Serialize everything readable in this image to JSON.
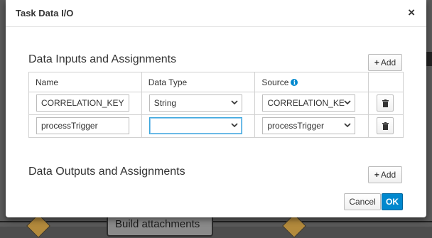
{
  "background": {
    "node_label": "Build attachments"
  },
  "dialog": {
    "title": "Task Data I/O",
    "close_symbol": "×",
    "inputs_section": {
      "title": "Data Inputs and Assignments",
      "add_label": "Add",
      "columns": [
        "Name",
        "Data Type",
        "Source"
      ],
      "rows": [
        {
          "name": "CORRELATION_KEY",
          "data_type": "String",
          "source": "CORRELATION_KE"
        },
        {
          "name": "processTrigger",
          "data_type": "",
          "source": "processTrigger"
        }
      ]
    },
    "outputs_section": {
      "title": "Data Outputs and Assignments",
      "add_label": "Add"
    },
    "cancel_label": "Cancel",
    "ok_label": "OK"
  },
  "colors": {
    "primary": "#0088ce",
    "focus_border": "#39a5dc"
  }
}
